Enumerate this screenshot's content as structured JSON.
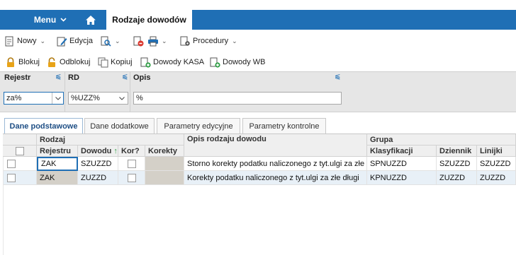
{
  "header": {
    "menu_label": "Menu",
    "active_tab": "Rodzaje dowodów"
  },
  "toolbar1": {
    "new_label": "Nowy",
    "edit_label": "Edycja",
    "procedures_label": "Procedury"
  },
  "toolbar2": {
    "lock_label": "Blokuj",
    "unlock_label": "Odblokuj",
    "copy_label": "Kopiuj",
    "kasa_label": "Dowody KASA",
    "wb_label": "Dowody WB"
  },
  "filters": {
    "rejestr": {
      "label": "Rejestr",
      "value": "za%"
    },
    "rd": {
      "label": "RD",
      "value": "%UZZ%"
    },
    "opis": {
      "label": "Opis",
      "value": "%"
    }
  },
  "panel_tabs": [
    "Dane podstawowe",
    "Dane dodatkowe",
    "Parametry edycyjne",
    "Parametry kontrolne"
  ],
  "grid": {
    "group_rodzaj": "Rodzaj",
    "group_opis": "Opis rodzaju dowodu",
    "group_grupa": "Grupa",
    "col_rejestr": "Rejestru",
    "col_dowodu": "Dowodu",
    "col_kor": "Kor?",
    "col_korekty": "Korekty",
    "col_klasyfikacji": "Klasyfikacji",
    "col_dziennik": "Dziennik",
    "col_linijki": "Linijki",
    "rows": [
      {
        "rejestr": "ZAK",
        "dowod": "SZUZZD",
        "opis": "Storno korekty podatku naliczonego z tyt.ulgi za złe",
        "klasyfikacja": "SPNUZZD",
        "dziennik": "SZUZZD",
        "linijki": "SZUZZD"
      },
      {
        "rejestr": "ZAK",
        "dowod": "ZUZZD",
        "opis": "Korekty podatku naliczonego z tyt.ulgi za złe długi",
        "klasyfikacja": "KPNUZZD",
        "dziennik": "ZUZZD",
        "linijki": "ZUZZD"
      }
    ]
  }
}
